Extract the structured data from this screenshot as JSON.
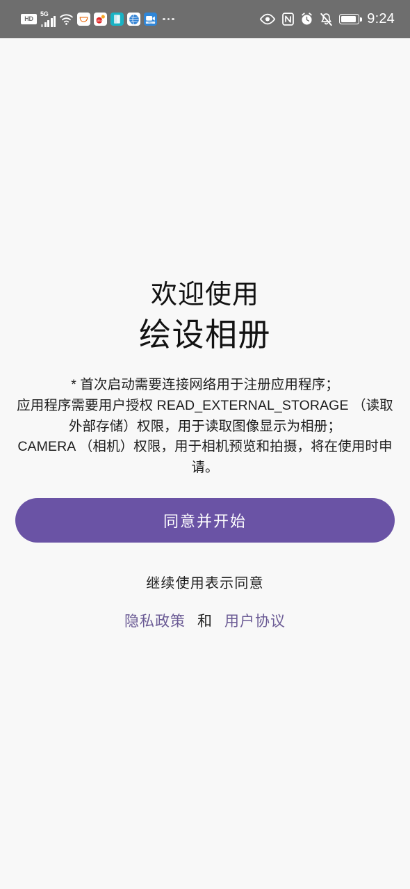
{
  "status_bar": {
    "background_color": "#6E6E6E",
    "foreground_color": "#FFFFFF",
    "hd_badge": "HD",
    "network_label": "5G",
    "signal_bars": 5,
    "left_icons": [
      "hd-badge-icon",
      "5g-signal-icon",
      "wifi-icon",
      "taobao-app-icon",
      "weibo-app-icon",
      "cyan-app-icon",
      "browser-globe-app-icon",
      "screen-recorder-app-icon",
      "more-icons-ellipsis"
    ],
    "right_icons": [
      "eye-care-icon",
      "nfc-icon",
      "alarm-clock-icon",
      "bell-muted-icon",
      "battery-icon"
    ],
    "battery_level_percent": 88,
    "clock": "9:24"
  },
  "main": {
    "title_welcome": "欢迎使用",
    "title_app": "绘设相册",
    "notice": "* 首次启动需要连接网络用于注册应用程序；\n应用程序需要用户授权 READ_EXTERNAL_STORAGE （读取外部存储）权限，用于读取图像显示为相册；\nCAMERA （相机）权限，用于相机预览和拍摄，将在使用时申请。",
    "cta_label": "同意并开始",
    "cta_color": "#6A53A5",
    "consent_note": "继续使用表示同意",
    "legal": {
      "privacy_label": "隐私政策",
      "conjunction": "和",
      "agreement_label": "用户协议",
      "link_color": "#6B5B95"
    },
    "background_color": "#F8F8F8"
  }
}
